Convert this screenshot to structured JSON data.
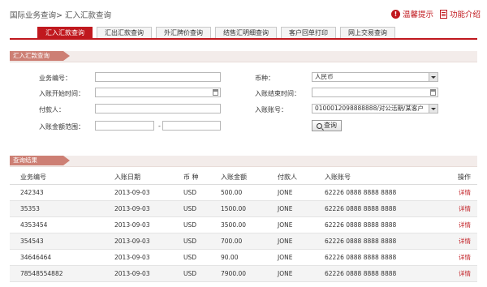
{
  "header": {
    "breadcrumb": "国际业务查询> 汇入汇款查询",
    "tip_label": "温馨提示",
    "func_label": "功能介绍"
  },
  "tabs": [
    {
      "label": "汇入汇款查询",
      "active": true
    },
    {
      "label": "汇出汇款查询",
      "active": false
    },
    {
      "label": "外汇牌价查询",
      "active": false
    },
    {
      "label": "结售汇明细查询",
      "active": false
    },
    {
      "label": "客户回单打印",
      "active": false
    },
    {
      "label": "网上交易查询",
      "active": false
    }
  ],
  "form": {
    "title": "汇入汇款查询",
    "biz_no_label": "业务编号：",
    "biz_no_value": "",
    "currency_label": "币种：",
    "currency_value": "人民币",
    "start_label": "入账开始时间：",
    "start_value": "",
    "end_label": "入账结束时间：",
    "end_value": "",
    "payer_label": "付款人：",
    "payer_value": "",
    "account_label": "入账账号：",
    "account_value": "0100012098888888/对公活期/某客户",
    "amount_label": "入账金额范围：",
    "amount_min": "",
    "amount_sep": "-",
    "amount_max": "",
    "query_button": "查询"
  },
  "results": {
    "title": "查询结果",
    "columns": [
      "业务编号",
      "入账日期",
      "币 种",
      "入账金额",
      "付款人",
      "入账账号",
      "操作"
    ],
    "rows": [
      [
        "242343",
        "2013-09-03",
        "USD",
        "500.00",
        "JONE",
        "62226 0888 8888 8888",
        "详情"
      ],
      [
        "35353",
        "2013-09-03",
        "USD",
        "1500.00",
        "JONE",
        "62226 0888 8888 8888",
        "详情"
      ],
      [
        "4353454",
        "2013-09-03",
        "USD",
        "3500.00",
        "JONE",
        "62226 0888 8888 8888",
        "详情"
      ],
      [
        "354543",
        "2013-09-03",
        "USD",
        "700.00",
        "JONE",
        "62226 0888 8888 8888",
        "详情"
      ],
      [
        "34646464",
        "2013-09-03",
        "USD",
        "90.00",
        "JONE",
        "62226 0888 8888 8888",
        "详情"
      ],
      [
        "78548554882",
        "2013-09-03",
        "USD",
        "7900.00",
        "JONE",
        "62226 0888 8888 8888",
        "详情"
      ]
    ]
  },
  "colors": {
    "accent": "#c0181e",
    "section_header": "#cd7f74"
  }
}
